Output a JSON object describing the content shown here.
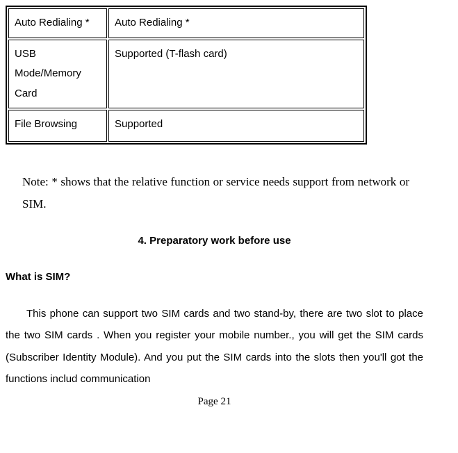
{
  "table": {
    "rows": [
      {
        "col1": "Auto Redialing *",
        "col2": "Auto Redialing *"
      },
      {
        "col1": "USB Mode/Memory Card",
        "col2": "Supported (T-flash card)"
      },
      {
        "col1": "File Browsing",
        "col2": "Supported"
      }
    ]
  },
  "note": "Note: * shows that the relative function or service needs support from network or SIM.",
  "section_title": "4. Preparatory work before use",
  "sub_heading": "What is SIM?",
  "paragraph": "This phone can support two SIM cards and two stand-by, there are two slot to place the two SIM cards . When you register your mobile number., you will get the SIM cards (Subscriber Identity Module). And you put the SIM cards into the slots then you'll got the functions includ communication",
  "page_number": "Page 21"
}
